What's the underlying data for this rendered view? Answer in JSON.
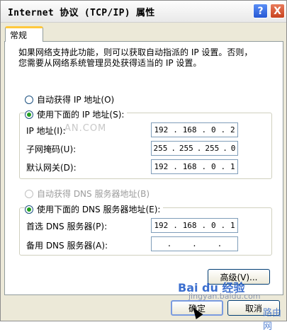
{
  "window": {
    "title": "Internet 协议 (TCP/IP) 属性",
    "help_glyph": "?",
    "close_glyph": "X"
  },
  "tab": {
    "label": "常规"
  },
  "description": {
    "line1": "如果网络支持此功能，则可以获取自动指派的 IP 设置。否则，",
    "line2": "您需要从网络系统管理员处获得适当的 IP 设置。"
  },
  "ip_mode": {
    "auto_label": "自动获得 IP 地址(O)",
    "manual_label": "使用下面的 IP 地址(S):",
    "selected": "manual"
  },
  "ip_fields": {
    "ip_label": "IP 地址(I):",
    "ip_value": [
      "192",
      "168",
      "0",
      "2"
    ],
    "mask_label": "子网掩码(U):",
    "mask_value": [
      "255",
      "255",
      "255",
      "0"
    ],
    "gateway_label": "默认网关(D):",
    "gateway_value": [
      "192",
      "168",
      "0",
      "1"
    ]
  },
  "dns_mode": {
    "auto_label": "自动获得 DNS 服务器地址(B)",
    "auto_enabled": false,
    "manual_label": "使用下面的 DNS 服务器地址(E):",
    "selected": "manual"
  },
  "dns_fields": {
    "primary_label": "首选 DNS 服务器(P):",
    "primary_value": [
      "192",
      "168",
      "0",
      "1"
    ],
    "alternate_label": "备用 DNS 服务器(A):",
    "alternate_value": [
      "",
      "",
      "",
      ""
    ]
  },
  "buttons": {
    "advanced": "高级(V)...",
    "ok": "确定",
    "cancel": "取消"
  },
  "watermarks": {
    "baidu": "Bai du 经验",
    "baidu_sub": "jingyan.baidu.com",
    "corner": "路由网",
    "url": "AN.COM"
  },
  "colors": {
    "accent_tab": "#ffc83c",
    "radio_dot": "#21a121",
    "help_button": "#2658d4",
    "close_button": "#c8431f"
  }
}
